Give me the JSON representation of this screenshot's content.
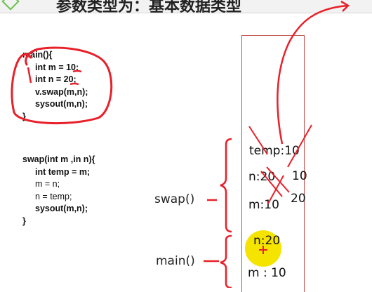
{
  "slide": {
    "title": "参数类型为：基本数据类型"
  },
  "main_code": {
    "line1": "main(){",
    "line2": "int m = 10;",
    "line3": "int n = 20;",
    "line4": "v.swap(m,n);",
    "line5": "sysout(m,n);",
    "line6": "}"
  },
  "swap_code": {
    "line1": "swap(int m ,in n){",
    "line2": "int temp = m;",
    "line3": "m = n;",
    "line4": "n = temp;",
    "line5": "sysout(m,n);",
    "line6": "}"
  },
  "frames": {
    "swap_label": "swap()",
    "main_label": "main()"
  },
  "stack": {
    "temp": "temp:10",
    "swap_n": "n:20",
    "swap_n_new": "10",
    "swap_m": "m:10",
    "swap_m_new": "20",
    "main_n": "n:20",
    "main_m": "m : 10"
  },
  "colors": {
    "annotation_red": "#e8202a",
    "stack_border": "#c0504d",
    "cursor_yellow": "#f5e400"
  }
}
